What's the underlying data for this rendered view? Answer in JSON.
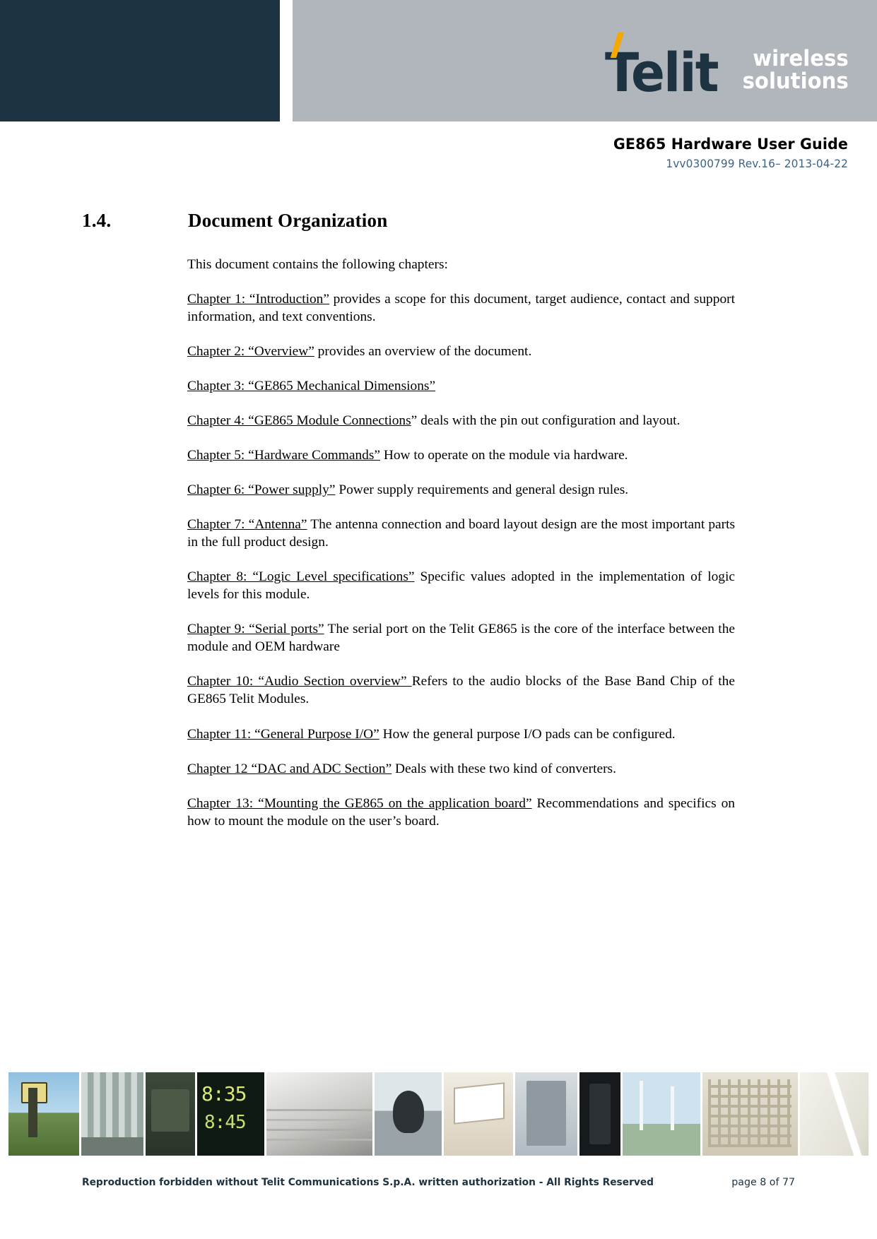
{
  "masthead": {
    "logo_word": "Telit",
    "logo_tagline_line1": "wireless",
    "logo_tagline_line2": "solutions",
    "dark_color": "#1d3341",
    "gray_color": "#b0b6bb",
    "accent_color": "#f5a800"
  },
  "header": {
    "title": "GE865 Hardware User Guide",
    "revision": "1vv0300799 Rev.16– 2013-04-22",
    "revision_color": "#3d6384"
  },
  "section": {
    "number": "1.4.",
    "title": "Document Organization"
  },
  "body": {
    "intro": "This document contains the following chapters:",
    "chapters": [
      {
        "underlined": "Chapter 1: “Introduction”",
        "rest": " provides a scope for this document, target audience, contact and support information, and text conventions."
      },
      {
        "underlined": "Chapter 2: “Overview”",
        "rest": " provides an overview of the document."
      },
      {
        "underlined": "Chapter 3: “GE865 Mechanical Dimensions”",
        "rest": ""
      },
      {
        "underlined": "Chapter 4: “GE865 Module Connections",
        "rest": "” deals with the pin out configuration and layout."
      },
      {
        "underlined": "Chapter 5: “Hardware Commands”",
        "rest": " How to operate on the module via hardware."
      },
      {
        "underlined": "Chapter 6: “Power supply”",
        "rest": " Power supply requirements and general design rules."
      },
      {
        "underlined": "Chapter 7: “Antenna”",
        "rest": " The antenna connection and board layout design are the most important parts in the full product design."
      },
      {
        "underlined": "Chapter 8: “Logic Level specifications”",
        "rest": " Specific values adopted in the implementation of logic levels for this module."
      },
      {
        "underlined": "Chapter 9: “Serial ports”",
        "rest": " The serial port on the Telit GE865 is the core of the interface between the module and OEM hardware"
      },
      {
        "underlined": "Chapter 10: “Audio Section overview” ",
        "rest": "Refers to the audio blocks of the Base Band Chip of the GE865 Telit Modules."
      },
      {
        "underlined": "Chapter 11: “General Purpose I/O”",
        "rest": " How the general purpose I/O pads can be configured."
      },
      {
        "underlined": "Chapter 12 “DAC and ADC Section”",
        "rest": " Deals with these two kind of converters."
      },
      {
        "underlined": "Chapter 13: “Mounting the GE865 on the application board”",
        "rest": " Recommendations and specifics on how to mount the module on the user’s board."
      }
    ]
  },
  "footer": {
    "note": "Reproduction forbidden without Telit Communications S.p.A. written authorization - All Rights Reserved",
    "page": "page 8 of 77"
  }
}
